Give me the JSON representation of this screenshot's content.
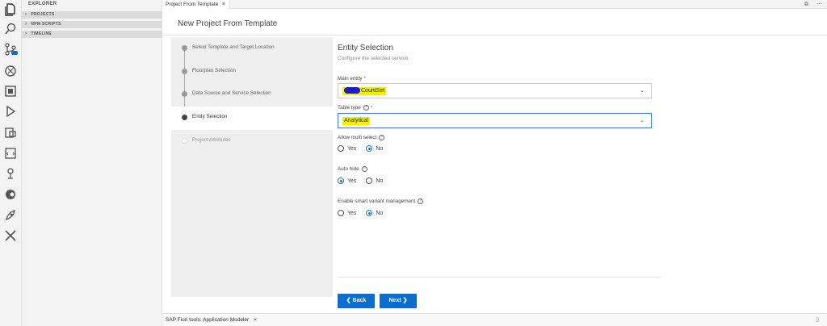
{
  "sidebar": {
    "title": "EXPLORER",
    "sections": [
      {
        "label": "PROJECTS"
      },
      {
        "label": "NPM SCRIPTS"
      },
      {
        "label": "TIMELINE"
      }
    ]
  },
  "activity_bar": {
    "icons": [
      "files-icon",
      "search-icon",
      "source-control-icon",
      "debug-icon",
      "extensions-icon",
      "run-icon",
      "storyboard-icon",
      "xml-icon",
      "deploy-icon",
      "toggle-icon",
      "rocket-icon",
      "tools-icon"
    ]
  },
  "editor_tab": {
    "label": "Project From Template",
    "close": "×"
  },
  "tab_actions": {
    "split": "⧉",
    "more": "⋯"
  },
  "page": {
    "title": "New Project From Template"
  },
  "steps": [
    {
      "label": "Select Template and Target Location",
      "state": "done"
    },
    {
      "label": "Floorplan Selection",
      "state": "done"
    },
    {
      "label": "Data Source and Service Selection",
      "state": "done"
    },
    {
      "label": "Entity Selection",
      "state": "active"
    },
    {
      "label": "Project Attributes",
      "state": "pending"
    }
  ],
  "form": {
    "title": "Entity Selection",
    "subtitle": "Configure the selected service.",
    "main_entity": {
      "label": "Main entity",
      "required": "*",
      "value": "CountSet"
    },
    "table_type": {
      "label": "Table type",
      "required": "*",
      "value": "Analytical"
    },
    "allow_multi_select": {
      "label": "Allow multi select",
      "options": [
        "Yes",
        "No"
      ],
      "selected": "No"
    },
    "auto_hide": {
      "label": "Auto hide",
      "options": [
        "Yes",
        "No"
      ],
      "selected": "Yes"
    },
    "smart_variant": {
      "label": "Enable smart variant management",
      "options": [
        "Yes",
        "No"
      ],
      "selected": "No"
    }
  },
  "buttons": {
    "back": "❮ Back",
    "next": "Next ❯"
  },
  "bottom_panel": {
    "tab_label": "SAP Fiori tools: Application Modeler",
    "close": "×"
  },
  "colors": {
    "accent": "#0a6ed1",
    "highlight": "#f2f200"
  }
}
